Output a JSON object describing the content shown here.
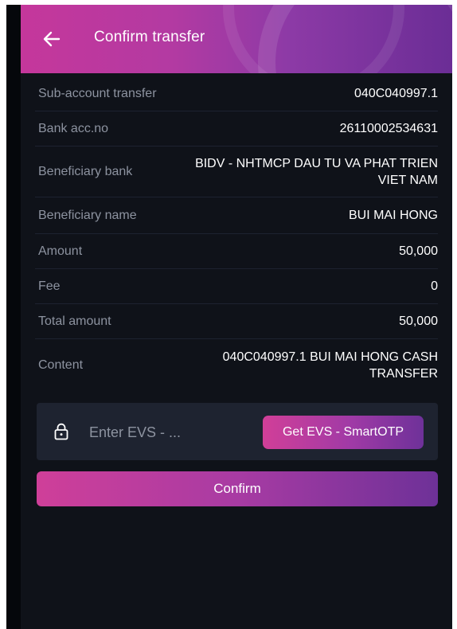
{
  "header": {
    "title": "Confirm transfer",
    "back_icon": "arrow-left-icon"
  },
  "details": {
    "sub_account": {
      "label": "Sub-account transfer",
      "value": "040C040997.1"
    },
    "bank_acc_no": {
      "label": "Bank acc.no",
      "value": "26110002534631"
    },
    "beneficiary_bank": {
      "label": "Beneficiary bank",
      "value": "BIDV - NHTMCP DAU TU VA PHAT TRIEN VIET NAM"
    },
    "beneficiary_name": {
      "label": "Beneficiary name",
      "value": "BUI MAI HONG"
    },
    "amount": {
      "label": "Amount",
      "value": "50,000"
    },
    "fee": {
      "label": "Fee",
      "value": "0"
    },
    "total_amount": {
      "label": "Total amount",
      "value": "50,000"
    },
    "content": {
      "label": "Content",
      "value": "040C040997.1 BUI MAI HONG CASH TRANSFER"
    }
  },
  "otp": {
    "placeholder": "Enter EVS - ...",
    "lock_icon": "lock-icon",
    "get_button_label": "Get EVS - SmartOTP"
  },
  "confirm_label": "Confirm",
  "colors": {
    "background": "#0f1219",
    "accent_start": "#c5379b",
    "accent_end": "#6b2d96",
    "label_text": "#8d93a0",
    "panel": "#1e2330"
  }
}
